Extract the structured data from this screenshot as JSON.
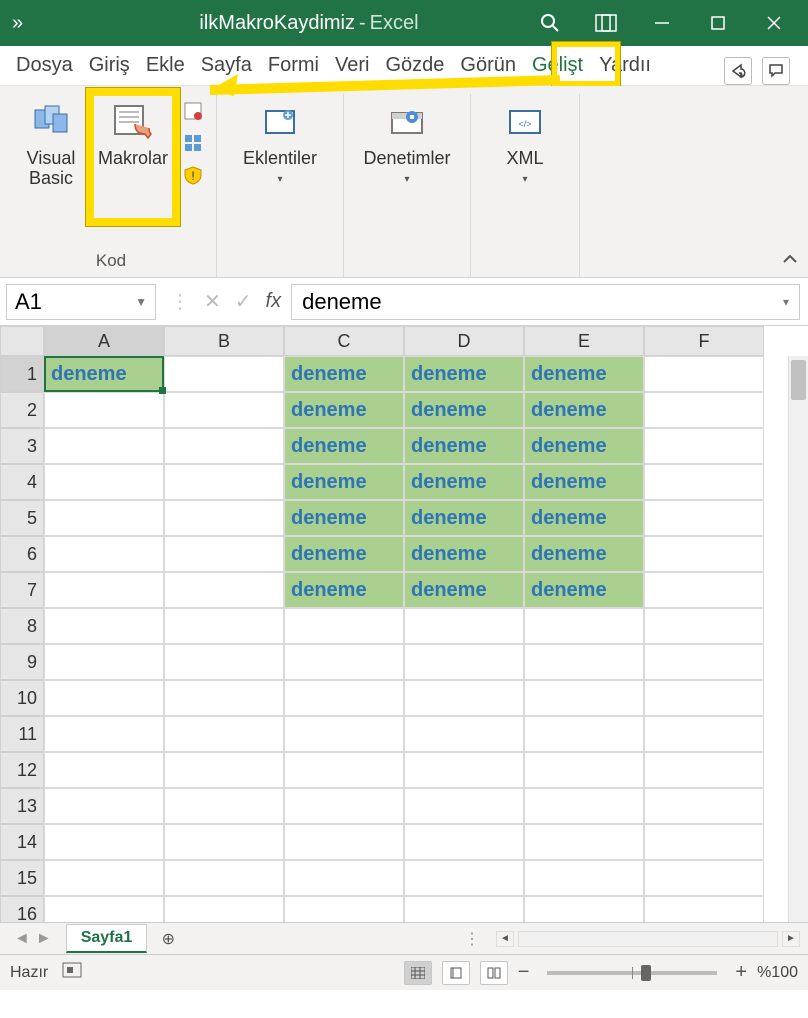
{
  "title": {
    "filename": "ilkMakroKaydimiz",
    "app": "Excel"
  },
  "tabs": [
    "Dosya",
    "Giriş",
    "Ekle",
    "Sayfa",
    "Formi",
    "Veri",
    "Gözde",
    "Görün",
    "Gelişt",
    "Yardıı"
  ],
  "active_tab": "Gelişt",
  "ribbon": {
    "group_kod": {
      "label": "Kod",
      "vb": "Visual Basic",
      "makrolar": "Makrolar"
    },
    "eklentiler": "Eklentiler",
    "denetimler": "Denetimler",
    "xml": "XML"
  },
  "namebox": "A1",
  "formula": "deneme",
  "columns": [
    "A",
    "B",
    "C",
    "D",
    "E",
    "F"
  ],
  "rows": [
    1,
    2,
    3,
    4,
    5,
    6,
    7,
    8,
    9,
    10,
    11,
    12,
    13,
    14,
    15,
    16
  ],
  "cells": {
    "A1": {
      "v": "deneme",
      "filled": true,
      "active": true
    },
    "C1": {
      "v": "deneme",
      "filled": true
    },
    "D1": {
      "v": "deneme",
      "filled": true
    },
    "E1": {
      "v": "deneme",
      "filled": true
    },
    "C2": {
      "v": "deneme",
      "filled": true
    },
    "D2": {
      "v": "deneme",
      "filled": true
    },
    "E2": {
      "v": "deneme",
      "filled": true
    },
    "C3": {
      "v": "deneme",
      "filled": true
    },
    "D3": {
      "v": "deneme",
      "filled": true
    },
    "E3": {
      "v": "deneme",
      "filled": true
    },
    "C4": {
      "v": "deneme",
      "filled": true
    },
    "D4": {
      "v": "deneme",
      "filled": true
    },
    "E4": {
      "v": "deneme",
      "filled": true
    },
    "C5": {
      "v": "deneme",
      "filled": true
    },
    "D5": {
      "v": "deneme",
      "filled": true
    },
    "E5": {
      "v": "deneme",
      "filled": true
    },
    "C6": {
      "v": "deneme",
      "filled": true
    },
    "D6": {
      "v": "deneme",
      "filled": true
    },
    "E6": {
      "v": "deneme",
      "filled": true
    },
    "C7": {
      "v": "deneme",
      "filled": true
    },
    "D7": {
      "v": "deneme",
      "filled": true
    },
    "E7": {
      "v": "deneme",
      "filled": true
    }
  },
  "sheet_tab": "Sayfa1",
  "status": {
    "ready": "Hazır",
    "zoom": "%100"
  }
}
